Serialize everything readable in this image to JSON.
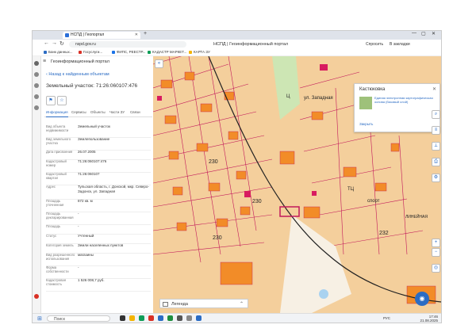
{
  "browser": {
    "tab_title": "НСПД | Геопортал",
    "new_tab": "+",
    "url": "nspd.gov.ru",
    "page_title": "НСПД | Геоинформационный портал",
    "toolbar_buttons": [
      "Спросить",
      "В закладки"
    ],
    "bookmarks": [
      "Банк данных...",
      "Госуслуги...",
      "ФИПС, РЕЕСТР...",
      "КАДАСТР МАРКЕТ...",
      "КАРТА ЗУ"
    ],
    "win_controls": [
      "—",
      "▢",
      "✕"
    ]
  },
  "panel": {
    "title": "Геоинформационный портал",
    "back_link": "Назад к найденным объектам",
    "object_title": "Земельный участок: 71:26:060107:476",
    "tabs": [
      "Информация",
      "Сервисы",
      "Объекты",
      "Части ЗУ",
      "Связи"
    ],
    "rows": [
      {
        "k": "Вид объекта недвижимости",
        "v": "Земельный участок"
      },
      {
        "k": "Вид земельного участка",
        "v": "Землепользование"
      },
      {
        "k": "Дата присвоения",
        "v": "26.07.2005"
      },
      {
        "k": "Кадастровый номер",
        "v": "71:26:060107:476"
      },
      {
        "k": "Кадастровый квартал",
        "v": "71:26:060107"
      },
      {
        "k": "Адрес",
        "v": "Тульская область, г. Донской, мкр. Северо-Задонск, ул. Западная"
      },
      {
        "k": "Площадь уточненная",
        "v": "872 кв. м"
      },
      {
        "k": "Площадь декларированная",
        "v": "-"
      },
      {
        "k": "Площадь",
        "v": "-"
      },
      {
        "k": "Статус",
        "v": "Учтенный"
      },
      {
        "k": "Категория земель",
        "v": "Земли населенных пунктов"
      },
      {
        "k": "Вид разрешенного использования",
        "v": "магазины"
      },
      {
        "k": "Форма собственности",
        "v": "-"
      },
      {
        "k": "Кадастровая стоимость",
        "v": "1 526 008,7 руб."
      }
    ]
  },
  "map": {
    "card_title": "Кастюковка",
    "card_text": "Единая электронная картографическая основа (базовый слой)",
    "card_more": "Закрыть",
    "legend": "Легенда",
    "quarter_labels": [
      "230",
      "230",
      "230",
      "232",
      "226"
    ],
    "street_labels": [
      "ТЦ",
      "ул. Западная",
      "спорт",
      "ЛИНЕЙНАЯ",
      "Ц"
    ],
    "fab_icon": "◉"
  },
  "taskbar": {
    "search": "Поиск",
    "time": "17:46",
    "date": "21.08.2025",
    "lang": "РУС"
  },
  "colors": {
    "land": "#f4cf9c",
    "building": "#f28c28",
    "parcel_line": "#c2185b",
    "accent": "#2b6cc4"
  }
}
